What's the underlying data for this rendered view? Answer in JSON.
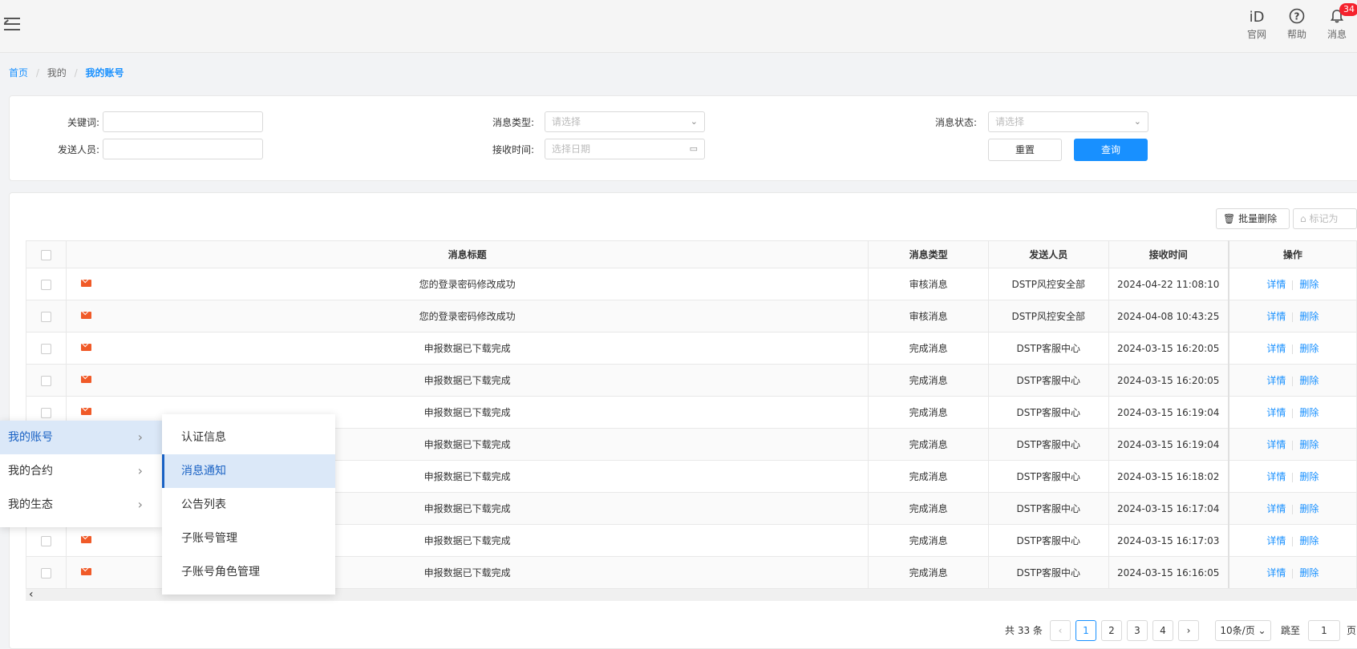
{
  "header": {
    "icons": [
      {
        "name": "official-site-icon",
        "label": "官网",
        "glyph": "ⅰD"
      },
      {
        "name": "help-icon",
        "label": "帮助",
        "glyph": "?"
      },
      {
        "name": "bell-icon",
        "label": "消息",
        "glyph": "🔔",
        "badge": "34"
      }
    ]
  },
  "breadcrumb": {
    "home": "首页",
    "mine": "我的",
    "current": "我的账号",
    "sep": "/"
  },
  "filters": {
    "keyword_label": "关键词:",
    "sender_label": "发送人员:",
    "type_label": "消息类型:",
    "type_placeholder": "请选择",
    "time_label": "接收时间:",
    "time_placeholder": "选择日期",
    "status_label": "消息状态:",
    "status_placeholder": "请选择",
    "reset": "重置",
    "query": "查询"
  },
  "toolbar": {
    "batch_delete": "批量删除",
    "mark_as": "标记为"
  },
  "table": {
    "headers": [
      "消息标题",
      "消息类型",
      "发送人员",
      "接收时间",
      "操作"
    ],
    "actions": {
      "detail": "详情",
      "delete": "删除"
    },
    "rows": [
      {
        "title": "您的登录密码修改成功",
        "type": "审核消息",
        "sender": "DSTP风控安全部",
        "time": "2024-04-22 11:08:10"
      },
      {
        "title": "您的登录密码修改成功",
        "type": "审核消息",
        "sender": "DSTP风控安全部",
        "time": "2024-04-08 10:43:25"
      },
      {
        "title": "申报数据已下载完成",
        "type": "完成消息",
        "sender": "DSTP客服中心",
        "time": "2024-03-15 16:20:05"
      },
      {
        "title": "申报数据已下载完成",
        "type": "完成消息",
        "sender": "DSTP客服中心",
        "time": "2024-03-15 16:20:05"
      },
      {
        "title": "申报数据已下载完成",
        "type": "完成消息",
        "sender": "DSTP客服中心",
        "time": "2024-03-15 16:19:04"
      },
      {
        "title": "申报数据已下载完成",
        "type": "完成消息",
        "sender": "DSTP客服中心",
        "time": "2024-03-15 16:19:04"
      },
      {
        "title": "申报数据已下载完成",
        "type": "完成消息",
        "sender": "DSTP客服中心",
        "time": "2024-03-15 16:18:02"
      },
      {
        "title": "申报数据已下载完成",
        "type": "完成消息",
        "sender": "DSTP客服中心",
        "time": "2024-03-15 16:17:04"
      },
      {
        "title": "申报数据已下载完成",
        "type": "完成消息",
        "sender": "DSTP客服中心",
        "time": "2024-03-15 16:17:03"
      },
      {
        "title": "申报数据已下载完成",
        "type": "完成消息",
        "sender": "DSTP客服中心",
        "time": "2024-03-15 16:16:05"
      }
    ]
  },
  "pagination": {
    "total": "共 33 条",
    "pages": [
      "1",
      "2",
      "3",
      "4"
    ],
    "current_page": "1",
    "page_size": "10条/页",
    "jump_label": "跳至",
    "jump_value": "1",
    "page_suffix": "页"
  },
  "menu": {
    "level1": [
      {
        "label": "我的账号",
        "active": true
      },
      {
        "label": "我的合约",
        "active": false
      },
      {
        "label": "我的生态",
        "active": false
      }
    ],
    "level2": [
      {
        "label": "认证信息",
        "active": false
      },
      {
        "label": "消息通知",
        "active": true
      },
      {
        "label": "公告列表",
        "active": false
      },
      {
        "label": "子账号管理",
        "active": false
      },
      {
        "label": "子账号角色管理",
        "active": false
      }
    ]
  }
}
